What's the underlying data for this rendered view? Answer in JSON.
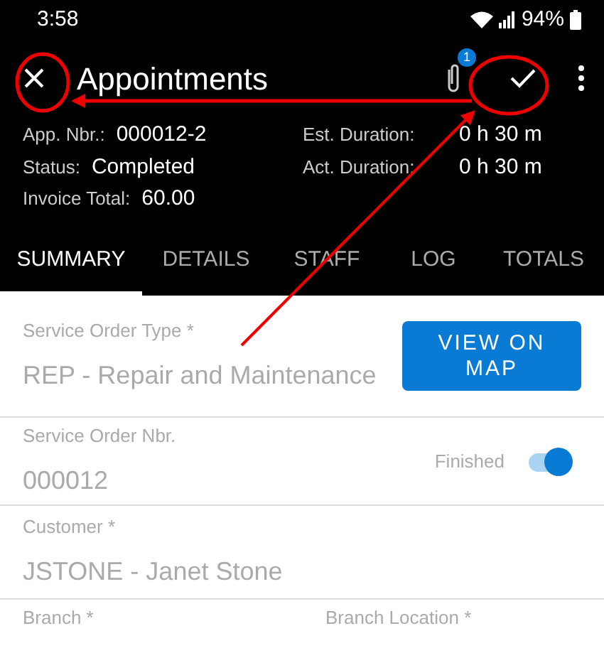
{
  "status_bar": {
    "time": "3:58",
    "battery": "94%"
  },
  "toolbar": {
    "title": "Appointments",
    "attachment_count": "1"
  },
  "header_fields": [
    {
      "label": "App. Nbr.:",
      "value": "000012-2"
    },
    {
      "label": "Est. Duration:",
      "value": "0 h 30 m"
    },
    {
      "label": "Status:",
      "value": "Completed"
    },
    {
      "label": "Act. Duration:",
      "value": "0 h 30 m"
    },
    {
      "label": "Invoice Total:",
      "value": "60.00"
    }
  ],
  "tabs": [
    {
      "label": "SUMMARY",
      "selected": true
    },
    {
      "label": "DETAILS",
      "selected": false
    },
    {
      "label": "STAFF",
      "selected": false
    },
    {
      "label": "LOG",
      "selected": false
    },
    {
      "label": "TOTALS",
      "selected": false
    }
  ],
  "form": {
    "service_order_type": {
      "label": "Service Order Type *",
      "value": "REP - Repair and Maintenance"
    },
    "map_button": "VIEW ON MAP",
    "service_order_nbr": {
      "label": "Service Order Nbr.",
      "value": "000012"
    },
    "finished": {
      "label": "Finished",
      "on": true
    },
    "customer": {
      "label": "Customer *",
      "value": "JSTONE - Janet Stone"
    },
    "branch": {
      "label": "Branch *"
    },
    "branch_location": {
      "label": "Branch Location *"
    }
  }
}
